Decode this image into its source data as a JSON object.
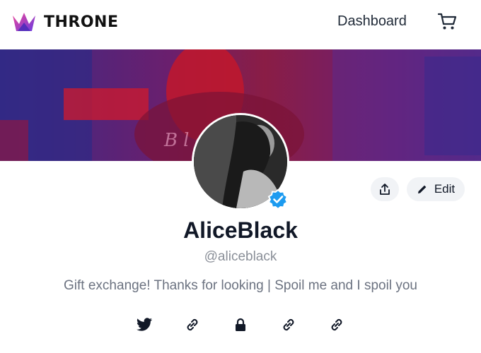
{
  "app": {
    "brand": "THRONE"
  },
  "nav": {
    "dashboard_label": "Dashboard",
    "cart_icon": "cart-icon"
  },
  "banner": {
    "overlay_text": "Black"
  },
  "profile": {
    "display_name": "AliceBlack",
    "handle": "@aliceblack",
    "bio": "Gift exchange! Thanks for looking | Spoil me and I spoil you",
    "verified_icon": "verified-badge-icon"
  },
  "actions": {
    "share_icon": "share-icon",
    "edit_label": "Edit",
    "edit_icon": "pencil-icon"
  },
  "socials": [
    "twitter-icon",
    "link-icon",
    "lock-icon",
    "link-icon",
    "link-icon"
  ],
  "colors": {
    "brand_purple": "#6c3be0",
    "brand_pink": "#e0449a",
    "verified_blue": "#1d9bf0"
  }
}
